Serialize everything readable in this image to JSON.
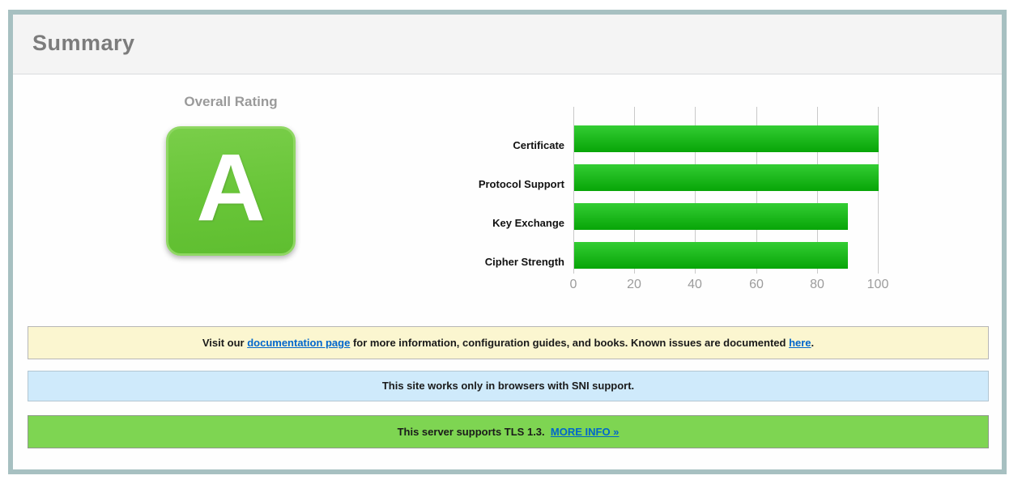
{
  "panel": {
    "title": "Summary"
  },
  "rating": {
    "label": "Overall Rating",
    "grade": "A"
  },
  "chart_data": {
    "type": "bar",
    "orientation": "horizontal",
    "title": "",
    "xlabel": "",
    "ylabel": "",
    "categories": [
      "Certificate",
      "Protocol Support",
      "Key Exchange",
      "Cipher Strength"
    ],
    "values": [
      100,
      100,
      90,
      90
    ],
    "xlim": [
      0,
      100
    ],
    "xticks": [
      0,
      20,
      40,
      60,
      80,
      100
    ],
    "grid": "vertical",
    "legend": "none",
    "bar_color_top": "#33cd33",
    "bar_color_bottom": "#07a507"
  },
  "banners": {
    "documentation": {
      "text_before": "Visit our ",
      "link_docs": "documentation page",
      "text_middle": " for more information, configuration guides, and books. Known issues are documented ",
      "link_here": "here",
      "text_after": "."
    },
    "sni": {
      "text": "This site works only in browsers with SNI support."
    },
    "tls": {
      "text": "This server supports TLS 1.3.",
      "link": "MORE INFO »"
    }
  },
  "colors": {
    "panel_border": "#a7c0c1",
    "header_bg": "#f4f4f4",
    "title_text": "#7c7c7c",
    "grade_badge_green": "#68c538",
    "bar_green": "#1db81d",
    "banner_yellow_bg": "#fbf6d0",
    "banner_blue_bg": "#cfeafb",
    "banner_green_bg": "#7ed552",
    "link_blue": "#0066cc"
  }
}
